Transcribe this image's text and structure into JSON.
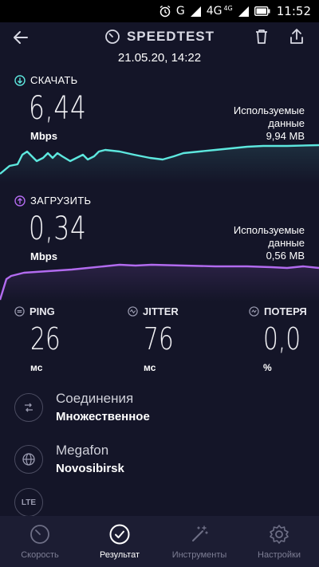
{
  "status": {
    "network_label": "G",
    "network_4g": "4G",
    "network_4g_small": "4G",
    "time": "11:52",
    "icons": [
      "alarm-icon",
      "signal-icon",
      "signal-icon",
      "battery-icon"
    ]
  },
  "header": {
    "title": "SPEEDTEST",
    "datetime": "21.05.20, 14:22"
  },
  "download": {
    "label": "СКАЧАТЬ",
    "value": "6,44",
    "unit": "Mbps",
    "data_label_line1": "Используемые",
    "data_label_line2": "данные",
    "data_amount": "9,94 MB",
    "color": "#5de7de"
  },
  "upload": {
    "label": "ЗАГРУЗИТЬ",
    "value": "0,34",
    "unit": "Mbps",
    "data_label_line1": "Используемые",
    "data_label_line2": "данные",
    "data_amount": "0,56 MB",
    "color": "#b26bef"
  },
  "metrics": {
    "ping": {
      "label": "PING",
      "value": "26",
      "unit": "мс"
    },
    "jitter": {
      "label": "JITTER",
      "value": "76",
      "unit": "мс"
    },
    "loss": {
      "label": "ПОТЕРЯ",
      "value": "0,0",
      "unit": "%"
    }
  },
  "connections": {
    "title": "Соединения",
    "value": "Множественное"
  },
  "provider": {
    "name": "Megafon",
    "location": "Novosibirsk"
  },
  "network_type": {
    "badge": "LTE"
  },
  "nav": {
    "items": [
      {
        "label": "Скорость",
        "icon": "speedometer-icon"
      },
      {
        "label": "Результат",
        "icon": "check-circle-icon"
      },
      {
        "label": "Инструменты",
        "icon": "magic-wand-icon"
      },
      {
        "label": "Настройки",
        "icon": "gear-icon"
      }
    ],
    "active_index": 1
  }
}
